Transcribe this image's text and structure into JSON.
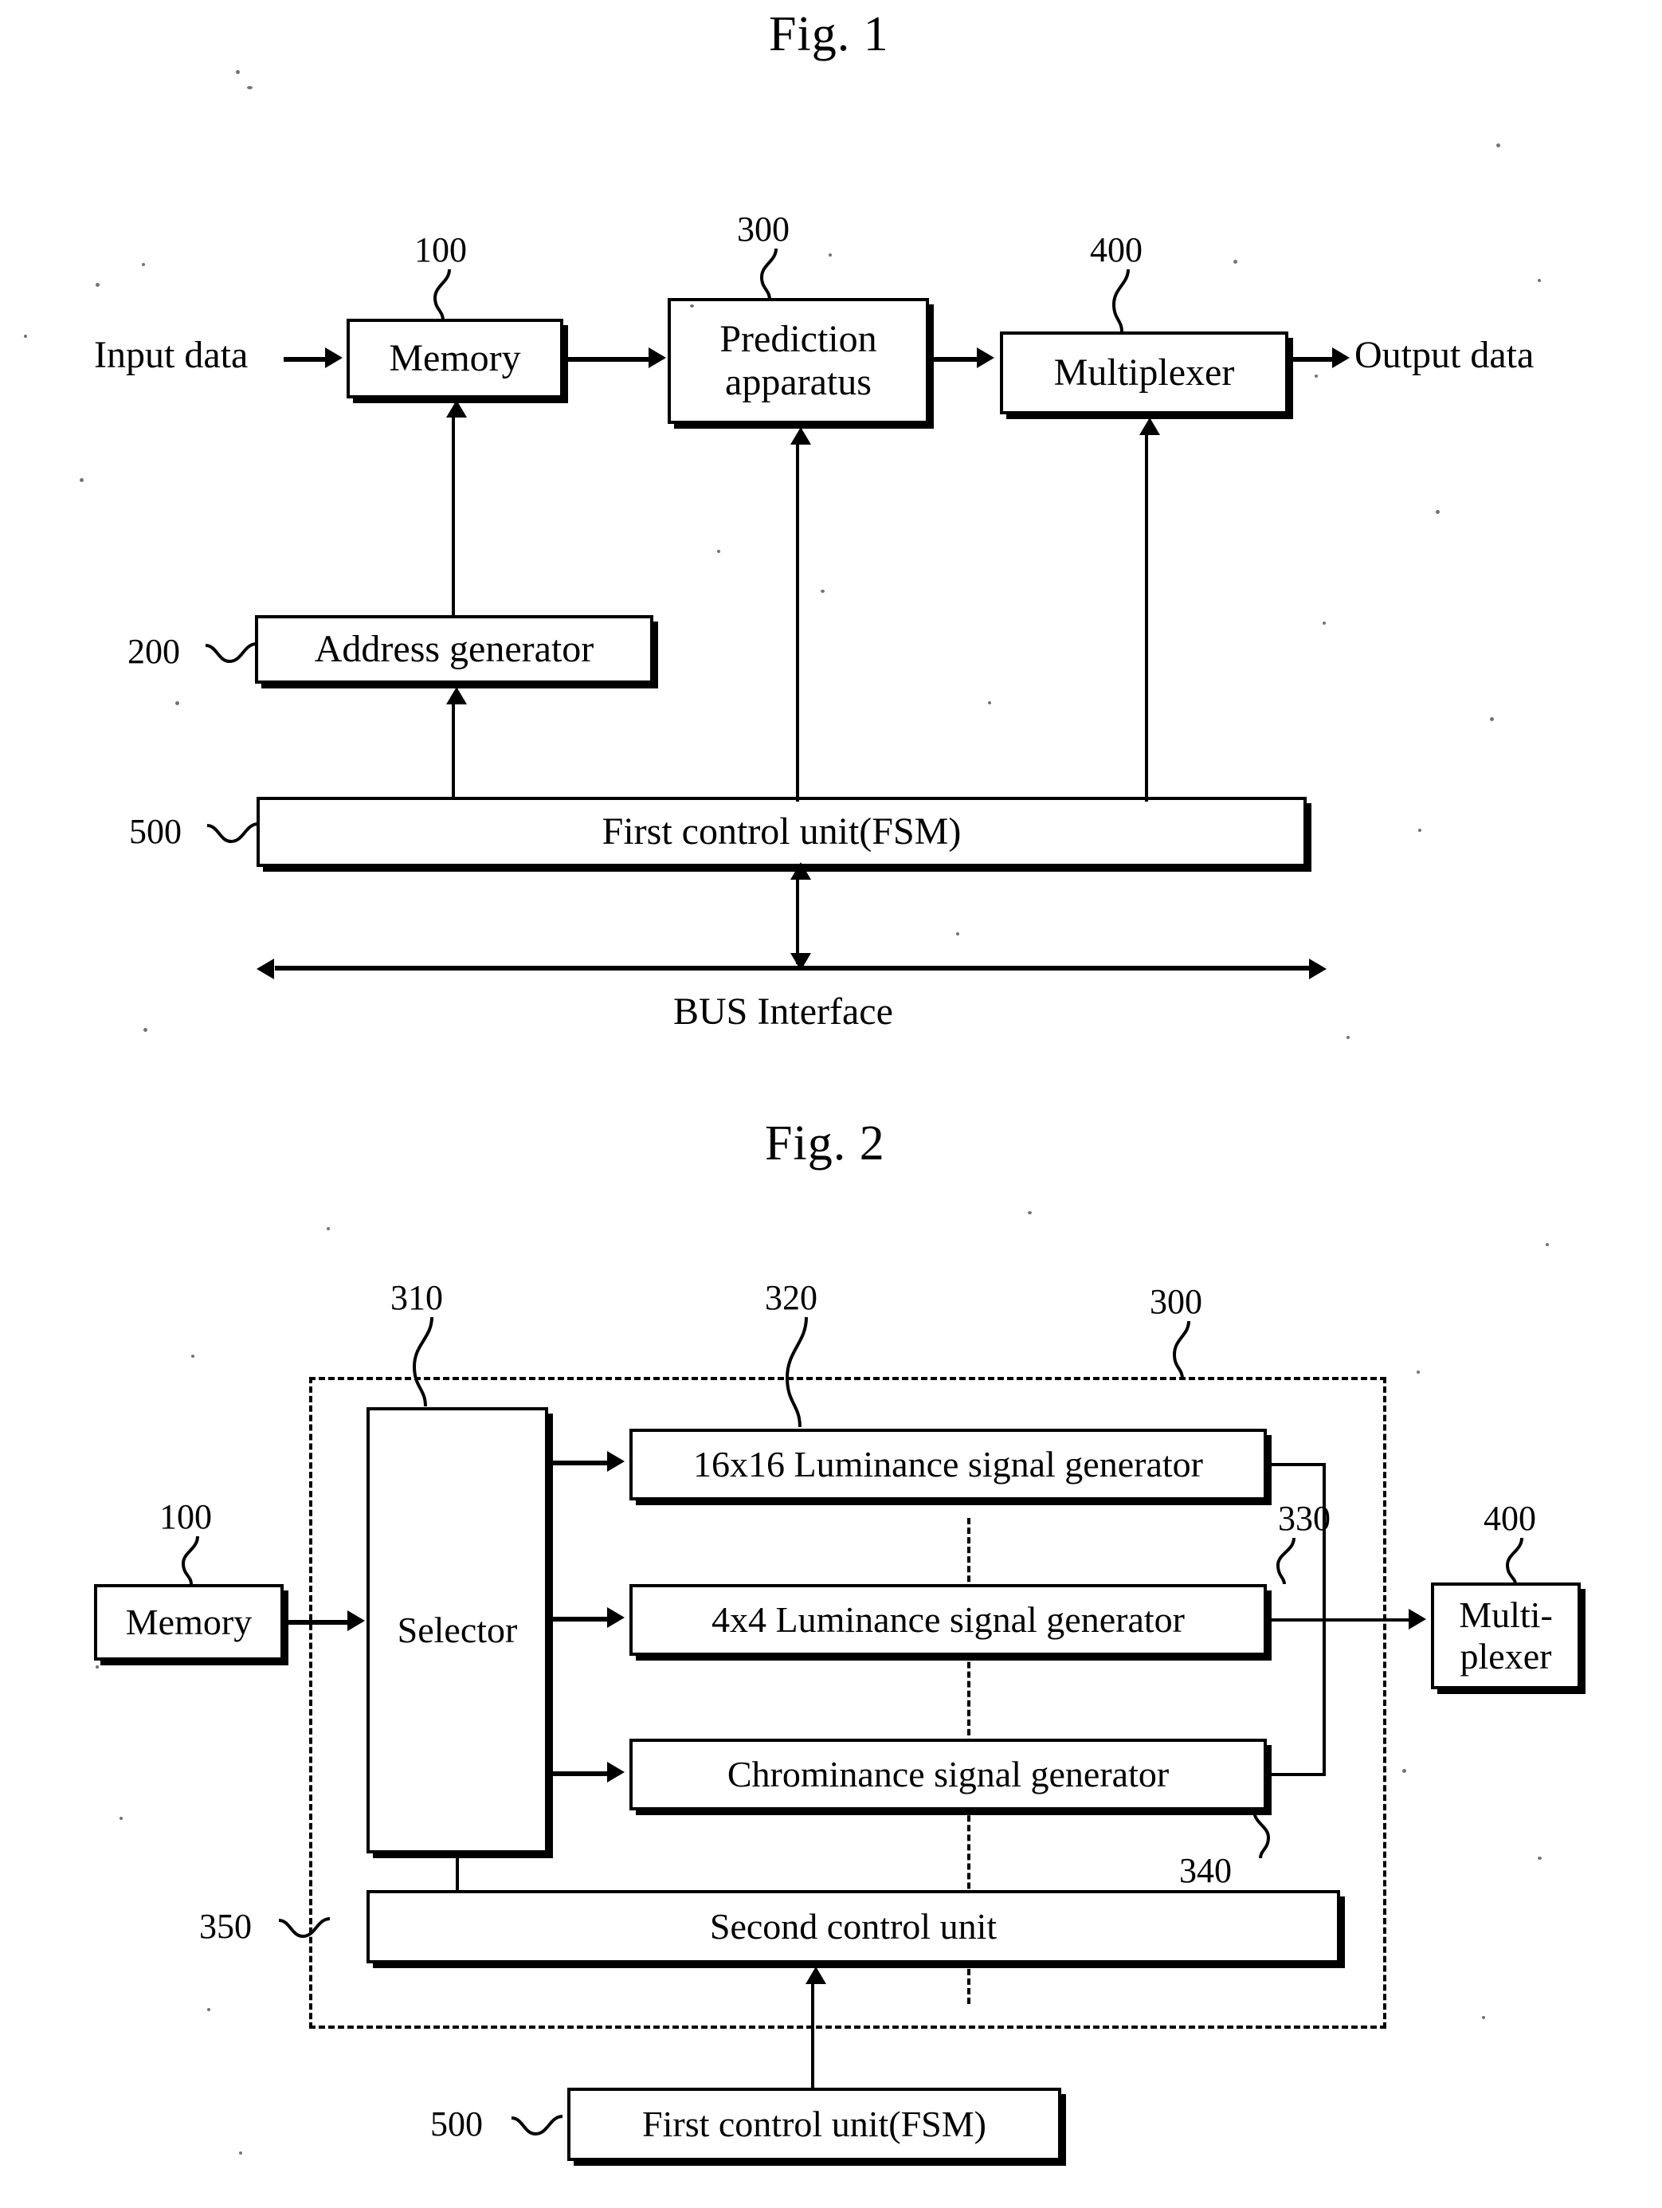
{
  "figures": [
    {
      "id": "fig1",
      "title": "Fig. 1",
      "blocks": [
        {
          "key": "memory",
          "label": "Memory",
          "ref": "100"
        },
        {
          "key": "prediction",
          "label": "Prediction\napparatus",
          "ref": "300"
        },
        {
          "key": "multiplexer",
          "label": "Multiplexer",
          "ref": "400"
        },
        {
          "key": "address_gen",
          "label": "Address generator",
          "ref": "200"
        },
        {
          "key": "first_control",
          "label": "First control unit(FSM)",
          "ref": "500"
        }
      ],
      "labels": {
        "input_data": "Input data",
        "output_data": "Output data",
        "bus_interface": "BUS Interface"
      }
    },
    {
      "id": "fig2",
      "title": "Fig. 2",
      "group_ref": "300",
      "blocks": [
        {
          "key": "memory",
          "label": "Memory",
          "ref": "100"
        },
        {
          "key": "selector",
          "label": "Selector",
          "ref": "310"
        },
        {
          "key": "lum16",
          "label": "16x16 Luminance signal generator",
          "ref": "320"
        },
        {
          "key": "lum4",
          "label": "4x4 Luminance signal generator",
          "ref": "330"
        },
        {
          "key": "chroma",
          "label": "Chrominance signal generator",
          "ref": "340"
        },
        {
          "key": "second_control",
          "label": "Second control unit",
          "ref": "350"
        },
        {
          "key": "multiplexer",
          "label": "Multi-\nplexer",
          "ref": "400"
        },
        {
          "key": "first_control",
          "label": "First control unit(FSM)",
          "ref": "500"
        }
      ]
    }
  ]
}
